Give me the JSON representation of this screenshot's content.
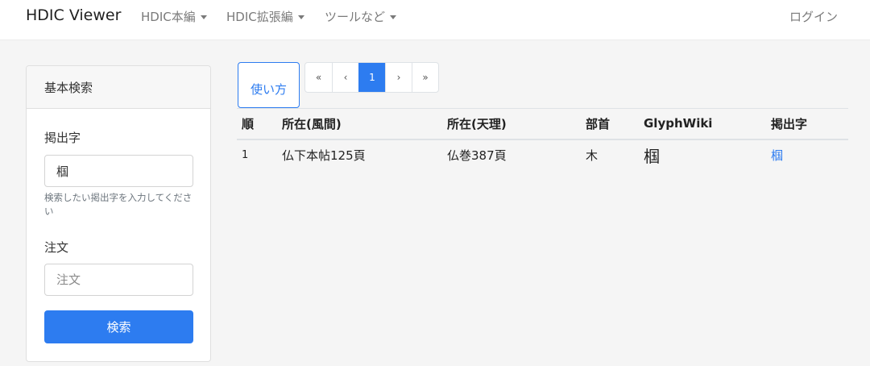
{
  "navbar": {
    "brand": "HDIC Viewer",
    "menus": [
      {
        "label": "HDIC本編"
      },
      {
        "label": "HDIC拡張編"
      },
      {
        "label": "ツールなど"
      }
    ],
    "login_label": "ログイン"
  },
  "sidebar": {
    "header": "基本検索",
    "midashi_label": "掲出字",
    "midashi_value": "椢",
    "midashi_help": "検索したい掲出字を入力してください",
    "chubun_label": "注文",
    "chubun_placeholder": "注文",
    "search_button": "検索"
  },
  "main": {
    "usage_button": "使い方",
    "pagination": [
      "«",
      "‹",
      "1",
      "›",
      "»"
    ],
    "active_page": "1",
    "table": {
      "headers": [
        "順",
        "所在(風間)",
        "所在(天理)",
        "部首",
        "GlyphWiki",
        "掲出字"
      ],
      "rows": [
        {
          "order": "1",
          "location_kazama": "仏下本帖125頁",
          "location_tenri": "仏巻387頁",
          "radical": "木",
          "glyphwiki": "椢",
          "character": "椢"
        }
      ]
    }
  },
  "colors": {
    "accent": "#2d7cf0",
    "page_background": "#f5f5f5"
  }
}
